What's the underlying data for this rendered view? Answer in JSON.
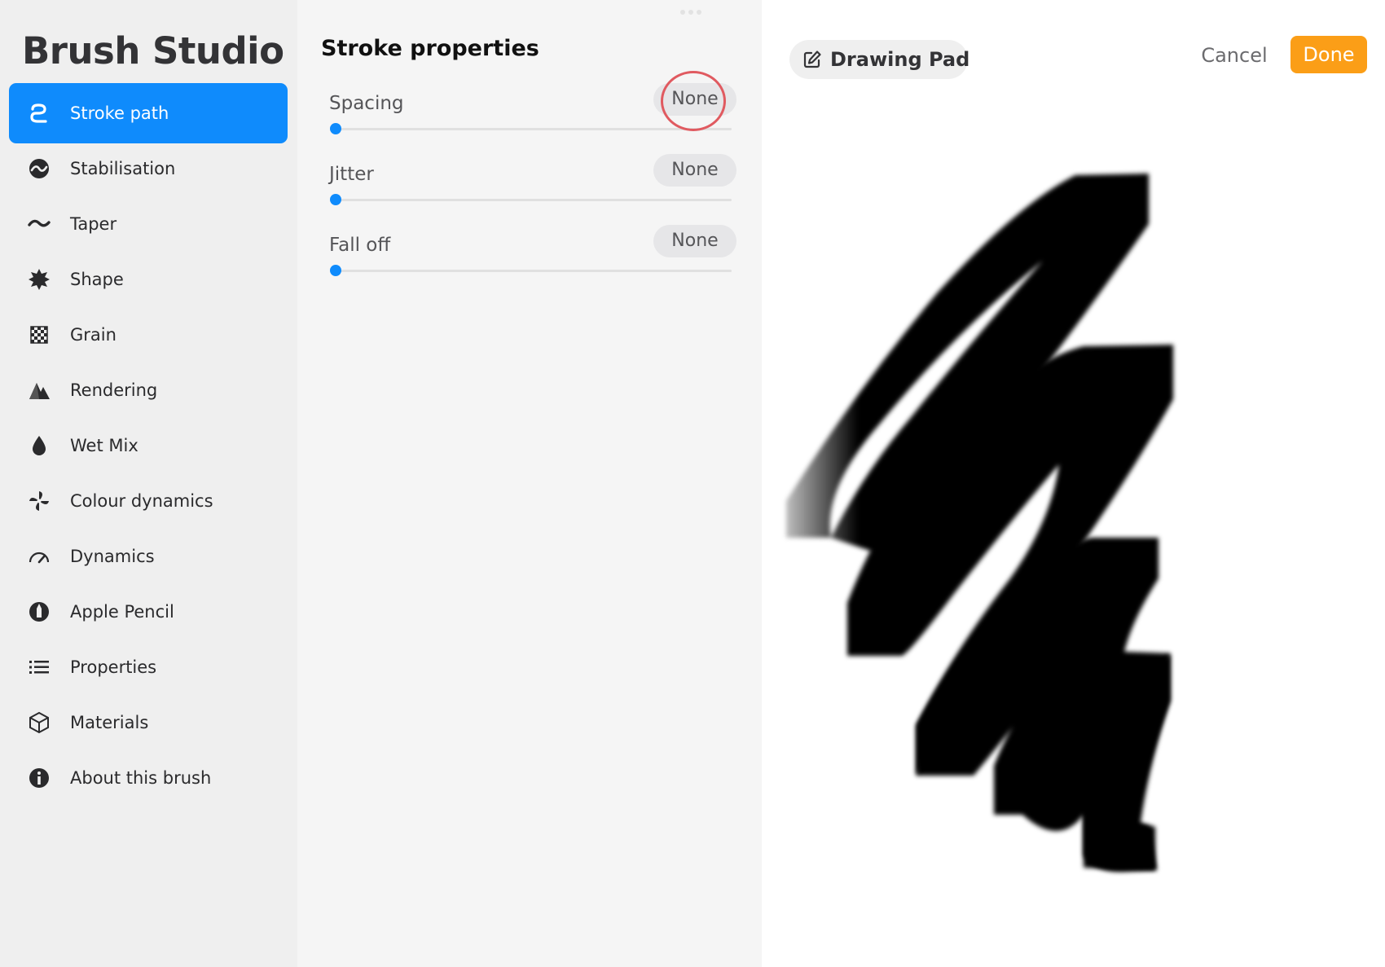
{
  "sidebar": {
    "title": "Brush Studio",
    "items": [
      {
        "label": "Stroke path",
        "icon": "stroke-path-icon",
        "active": true
      },
      {
        "label": "Stabilisation",
        "icon": "stabilisation-icon"
      },
      {
        "label": "Taper",
        "icon": "taper-icon"
      },
      {
        "label": "Shape",
        "icon": "shape-icon"
      },
      {
        "label": "Grain",
        "icon": "grain-icon"
      },
      {
        "label": "Rendering",
        "icon": "rendering-icon"
      },
      {
        "label": "Wet Mix",
        "icon": "wet-mix-icon"
      },
      {
        "label": "Colour dynamics",
        "icon": "colour-dynamics-icon"
      },
      {
        "label": "Dynamics",
        "icon": "dynamics-icon"
      },
      {
        "label": "Apple Pencil",
        "icon": "apple-pencil-icon"
      },
      {
        "label": "Properties",
        "icon": "properties-icon"
      },
      {
        "label": "Materials",
        "icon": "materials-icon"
      },
      {
        "label": "About this brush",
        "icon": "info-icon"
      }
    ]
  },
  "panel": {
    "title": "Stroke properties",
    "properties": [
      {
        "label": "Spacing",
        "value": "None",
        "level": 0
      },
      {
        "label": "Jitter",
        "value": "None",
        "level": 0
      },
      {
        "label": "Fall off",
        "value": "None",
        "level": 0
      }
    ]
  },
  "drawing_pad": {
    "label": "Drawing Pad",
    "icon": "edit-icon"
  },
  "actions": {
    "cancel_label": "Cancel",
    "done_label": "Done"
  },
  "colors": {
    "accent": "#0f8bfc",
    "done": "#fb9e17",
    "annotation": "#e05a60"
  }
}
